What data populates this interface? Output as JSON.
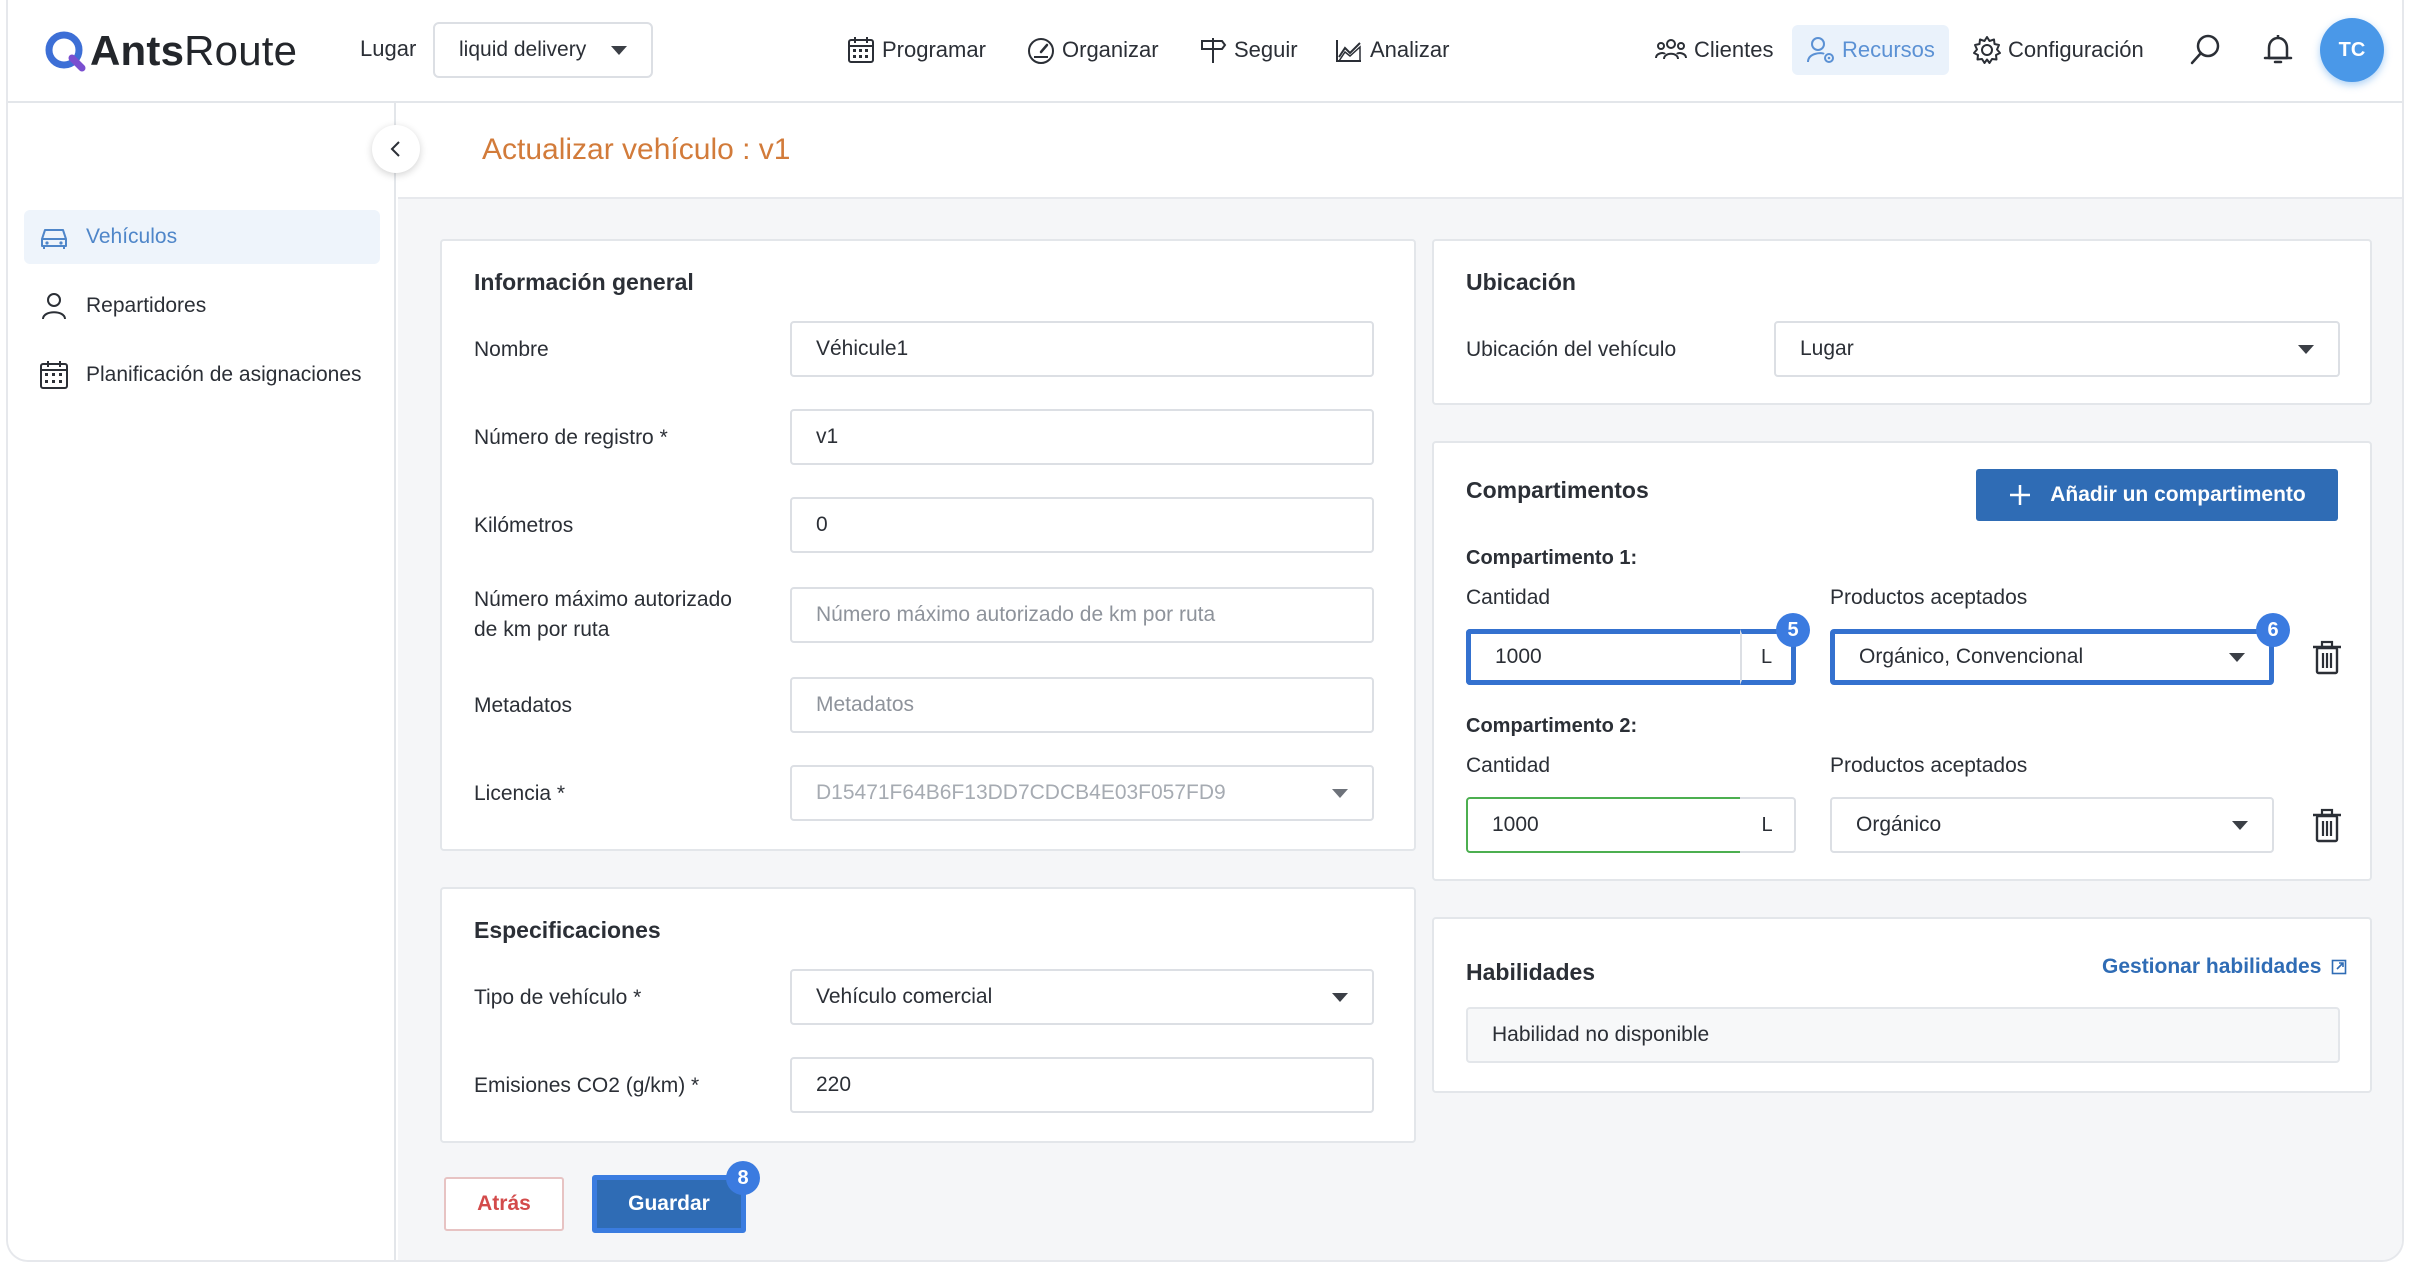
{
  "header": {
    "logo_bold": "Ants",
    "logo_light": "Route",
    "place_label": "Lugar",
    "place_value": "liquid delivery",
    "nav": {
      "programar": "Programar",
      "organizar": "Organizar",
      "seguir": "Seguir",
      "analizar": "Analizar",
      "clientes": "Clientes",
      "recursos": "Recursos",
      "configuracion": "Configuración"
    },
    "avatar_initials": "TC"
  },
  "sidebar": {
    "items": [
      {
        "label": "Vehículos",
        "icon": "car-icon",
        "active": true
      },
      {
        "label": "Repartidores",
        "icon": "person-icon"
      },
      {
        "label": "Planificación de asignaciones",
        "icon": "calendar-icon"
      }
    ]
  },
  "page": {
    "title": "Actualizar vehículo : v1"
  },
  "general": {
    "title": "Información general",
    "name_label": "Nombre",
    "name_value": "Véhicule1",
    "registration_label": "Número de registro *",
    "registration_value": "v1",
    "km_label": "Kilómetros",
    "km_value": "0",
    "max_km_label_line1": "Número máximo autorizado",
    "max_km_label_line2": "de km por ruta",
    "max_km_placeholder": "Número máximo autorizado de km por ruta",
    "metadata_label": "Metadatos",
    "metadata_placeholder": "Metadatos",
    "license_label": "Licencia *",
    "license_value": "D15471F64B6F13DD7CDCB4E03F057FD9"
  },
  "specs": {
    "title": "Especificaciones",
    "type_label": "Tipo de vehículo *",
    "type_value": "Vehículo comercial",
    "co2_label": "Emisiones CO2 (g/km) *",
    "co2_value": "220"
  },
  "location": {
    "title": "Ubicación",
    "label": "Ubicación del vehículo",
    "value": "Lugar"
  },
  "compartments": {
    "title": "Compartimentos",
    "add_button": "Añadir un compartimento",
    "items": [
      {
        "title": "Compartimento 1:",
        "qty_label": "Cantidad",
        "qty_value": "1000",
        "unit": "L",
        "products_label": "Productos aceptados",
        "products_value": "Orgánico, Convencional"
      },
      {
        "title": "Compartimento 2:",
        "qty_label": "Cantidad",
        "qty_value": "1000",
        "unit": "L",
        "products_label": "Productos aceptados",
        "products_value": "Orgánico"
      }
    ]
  },
  "skills": {
    "title": "Habilidades",
    "manage_link": "Gestionar habilidades",
    "empty_text": "Habilidad no disponible"
  },
  "actions": {
    "back": "Atrás",
    "save": "Guardar"
  },
  "badges": {
    "qty": "5",
    "products": "6",
    "save": "8"
  },
  "colors": {
    "accent": "#2f6cb5",
    "title_orange": "#d27b3a",
    "highlight": "#3471cf",
    "valid_green": "#4caf50"
  }
}
